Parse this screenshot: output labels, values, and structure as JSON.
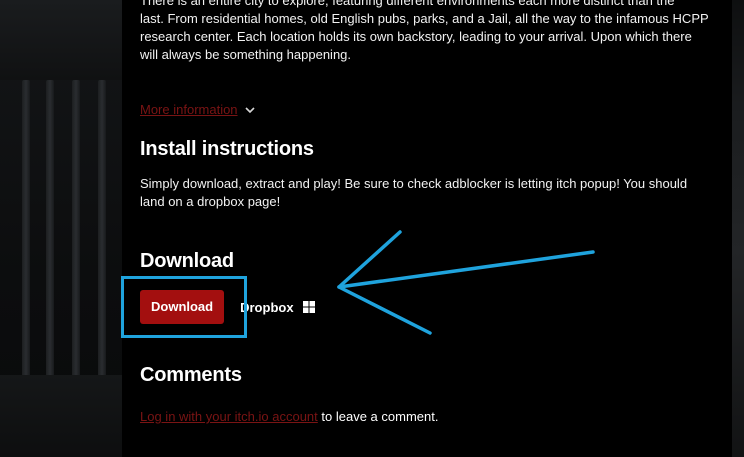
{
  "intro": {
    "line1": "There is an entire city to explore, featuring different environments each more distinct than the",
    "line2": "last. From residential homes, old English pubs, parks, and a Jail, all the way to the infamous HCPP",
    "line3": "research center. Each location holds its own backstory, leading to your arrival. Upon which there",
    "line4": "will always be something happening."
  },
  "more_info": {
    "label": "More information",
    "icon": "chevron-down-icon"
  },
  "install": {
    "title": "Install instructions",
    "line1": "Simply download, extract and play! Be sure to check adblocker is letting itch popup! You should",
    "line2": "land on a dropbox page!"
  },
  "download": {
    "title": "Download",
    "button_label": "Download",
    "file_name": "Dropbox",
    "platform_icon": "windows-icon"
  },
  "comments": {
    "title": "Comments",
    "login_link": "Log in with your itch.io account",
    "suffix": " to leave a comment."
  },
  "colors": {
    "accent_red": "#a30f0f",
    "link_red": "#7a1414",
    "annotation_blue": "#1fa3dd"
  }
}
